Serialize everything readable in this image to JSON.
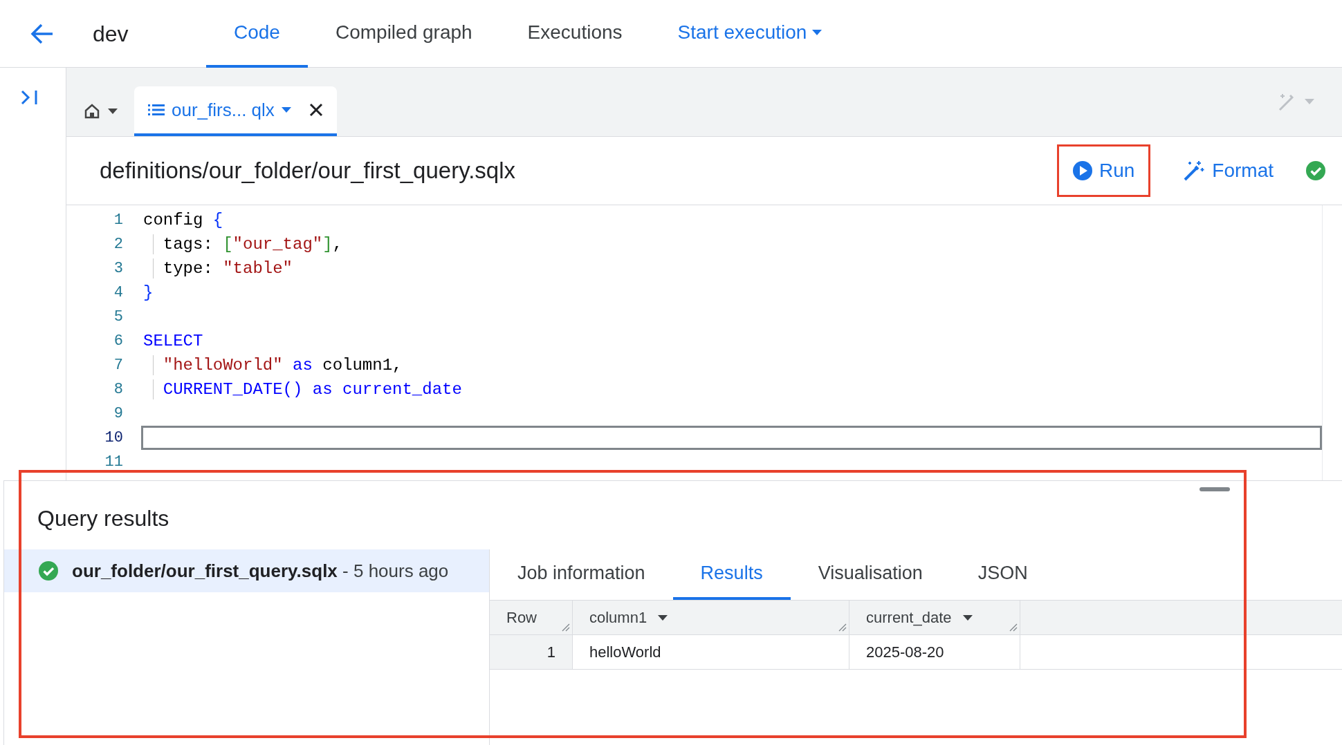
{
  "top_bar": {
    "title": "dev",
    "tabs": [
      {
        "label": "Code",
        "kind": "tab",
        "selected": true
      },
      {
        "label": "Compiled graph",
        "kind": "tab",
        "selected": false
      },
      {
        "label": "Executions",
        "kind": "tab",
        "selected": false
      },
      {
        "label": "Start execution",
        "kind": "dropdown",
        "selected": false
      }
    ]
  },
  "file_tabs": [
    {
      "label": "our_firs... qlx",
      "selected": true
    }
  ],
  "file_header": {
    "path": "definitions/our_folder/our_first_query.sqlx",
    "actions": [
      {
        "label": "Run",
        "kind": "run",
        "highlighted": true
      },
      {
        "label": "Format",
        "kind": "format",
        "highlighted": false
      }
    ]
  },
  "editor": {
    "lines": [
      {
        "number": "1",
        "indented": false,
        "current": false,
        "tokens": [
          {
            "kind": "text",
            "text": "config "
          },
          {
            "kind": "bracket",
            "text": "{"
          }
        ]
      },
      {
        "number": "2",
        "indented": true,
        "current": false,
        "tokens": [
          {
            "kind": "text",
            "text": "tags: "
          },
          {
            "kind": "bracket2",
            "text": "["
          },
          {
            "kind": "string",
            "text": "\"our_tag\""
          },
          {
            "kind": "bracket2",
            "text": "]"
          },
          {
            "kind": "text",
            "text": ","
          }
        ]
      },
      {
        "number": "3",
        "indented": true,
        "current": false,
        "tokens": [
          {
            "kind": "text",
            "text": "type: "
          },
          {
            "kind": "string",
            "text": "\"table\""
          }
        ]
      },
      {
        "number": "4",
        "indented": false,
        "current": false,
        "tokens": [
          {
            "kind": "bracket",
            "text": "}"
          }
        ]
      },
      {
        "number": "5",
        "indented": false,
        "current": false
      },
      {
        "number": "6",
        "indented": false,
        "current": false,
        "tokens": [
          {
            "kind": "keyword",
            "text": "SELECT"
          }
        ]
      },
      {
        "number": "7",
        "indented": true,
        "current": false,
        "tokens": [
          {
            "kind": "string",
            "text": "\"helloWorld\""
          },
          {
            "kind": "keyword",
            "text": " as"
          },
          {
            "kind": "text",
            "text": " column1,"
          }
        ]
      },
      {
        "number": "8",
        "indented": true,
        "current": false,
        "tokens": [
          {
            "kind": "keyword",
            "text": "CURRENT_DATE() as current_date"
          }
        ]
      },
      {
        "number": "9",
        "indented": false,
        "current": false
      },
      {
        "number": "10",
        "indented": false,
        "current": true
      },
      {
        "number": "11",
        "indented": false,
        "current": false
      }
    ]
  },
  "results": {
    "title": "Query results",
    "highlighted": true,
    "history": [
      {
        "text": "**our_folder/our_first_query.sqlx** - 5 hours ago",
        "selected": true
      }
    ],
    "tabs": [
      {
        "label": "Job information",
        "selected": false
      },
      {
        "label": "Results",
        "selected": true
      },
      {
        "label": "Visualisation",
        "selected": false
      },
      {
        "label": "JSON",
        "selected": false
      }
    ],
    "table": {
      "columns": [
        {
          "label": "Row",
          "menu": false
        },
        {
          "label": "column1",
          "menu": true
        },
        {
          "label": "current_date",
          "menu": true
        }
      ],
      "rows": [
        [
          "1",
          "helloWorld",
          "2025-08-20"
        ]
      ]
    }
  }
}
